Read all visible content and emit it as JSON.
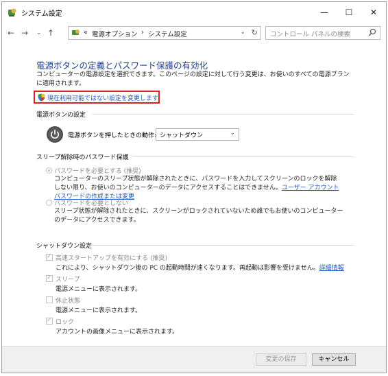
{
  "window": {
    "title": "システム設定",
    "controls": {
      "minimize": "—",
      "maximize": "☐",
      "close": "✕"
    }
  },
  "nav": {
    "back": "←",
    "forward": "→",
    "recent": "⌄",
    "up": "↑"
  },
  "address": {
    "prefix": "«",
    "crumbs": [
      "電源オプション",
      "システム設定"
    ],
    "separator": "›",
    "dropdown": "⌄",
    "refresh": "↻"
  },
  "search": {
    "placeholder": "コントロール パネルの検索"
  },
  "page": {
    "title": "電源ボタンの定義とパスワード保護の有効化",
    "description": "コンピューターの電源設定を選択できます。このページの設定に対して行う変更は、お使いのすべての電源プランに適用されます。",
    "admin_link": "現在利用可能ではない設定を変更します"
  },
  "power_button": {
    "heading": "電源ボタンの設定",
    "label": "電源ボタンを押したときの動作:",
    "selected": "シャットダウン",
    "dropdown_arrow": "⌄"
  },
  "password": {
    "heading": "スリープ解除時のパスワード保護",
    "options": [
      {
        "label": "パスワードを必要とする (推奨)",
        "desc": "コンピューターのスリープ状態が解除されたときに、パスワードを入力してスクリーンのロックを解除しない限り、お使いのコンピューターのデータにアクセスすることはできません。",
        "link": "ユーザー アカウント パスワードの作成または変更",
        "selected": true
      },
      {
        "label": "パスワードを必要としない",
        "desc": "スリープ状態が解除されたときに、スクリーンがロックされていないため誰でもお使いのコンピューターのデータにアクセスできます。",
        "selected": false
      }
    ]
  },
  "shutdown": {
    "heading": "シャットダウン設定",
    "items": [
      {
        "label": "高速スタートアップを有効にする (推奨)",
        "desc": "これにより、シャットダウン後の PC の起動時間が速くなります。再起動は影響を受けません。",
        "link": "詳細情報",
        "checked": true
      },
      {
        "label": "スリープ",
        "desc": "電源メニューに表示されます。",
        "checked": true
      },
      {
        "label": "休止状態",
        "desc": "電源メニューに表示されます。",
        "checked": false
      },
      {
        "label": "ロック",
        "desc": "アカウントの画像メニューに表示されます。",
        "checked": true
      }
    ]
  },
  "footer": {
    "save": "変更の保存",
    "cancel": "キャンセル"
  },
  "colors": {
    "title_blue": "#1e3d8f",
    "link_blue": "#1e57c6",
    "highlight_red": "#e02020",
    "disabled_gray": "#8a8a8a"
  }
}
